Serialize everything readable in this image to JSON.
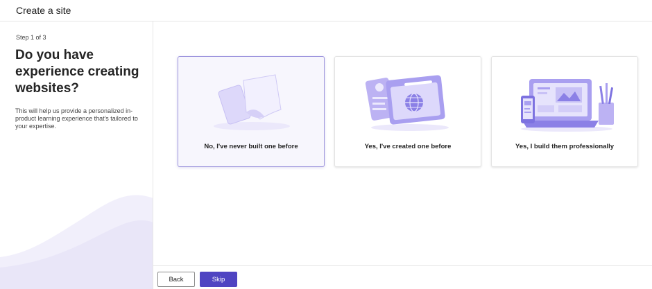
{
  "header": {
    "title": "Create a site"
  },
  "left": {
    "step": "Step 1 of 3",
    "question": "Do you have experience creating websites?",
    "help": "This will help us provide a personalized in-product learning experience that's tailored to your expertise."
  },
  "options": [
    {
      "label": "No, I've never built one before",
      "selected": true
    },
    {
      "label": "Yes, I've created one before",
      "selected": false
    },
    {
      "label": "Yes, I build them professionally",
      "selected": false
    }
  ],
  "footer": {
    "back_label": "Back",
    "skip_label": "Skip"
  },
  "colors": {
    "accent": "#4f44c2",
    "illustration": "#a99ff0",
    "selected_border": "#9d95dd"
  }
}
